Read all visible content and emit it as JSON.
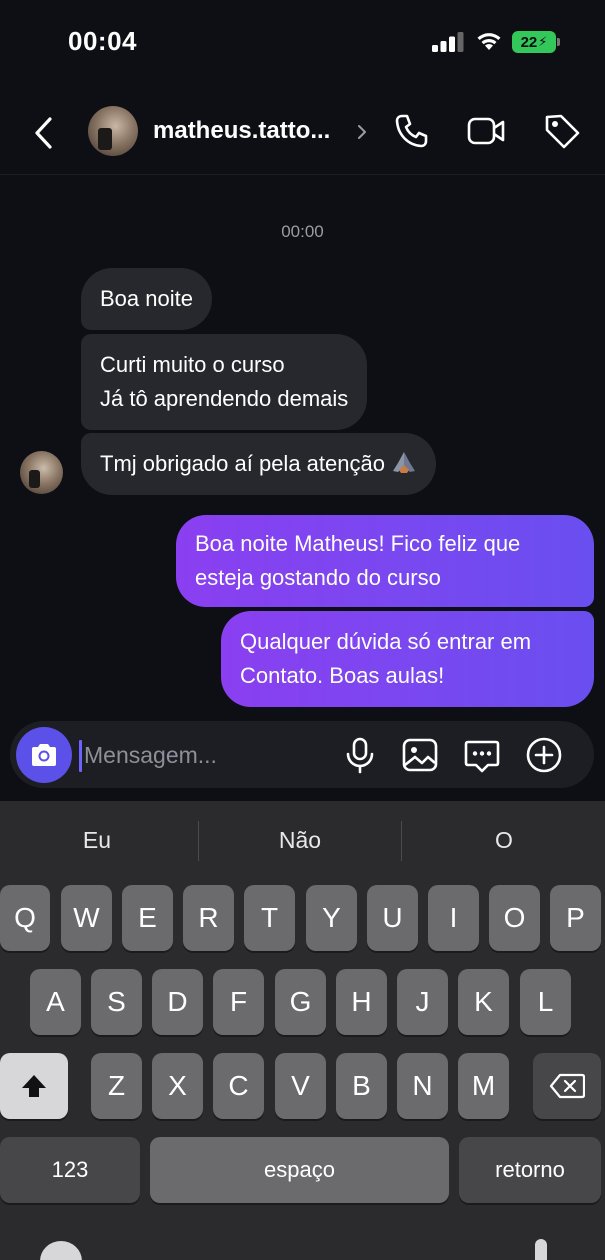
{
  "status": {
    "time": "00:04",
    "battery": "22"
  },
  "header": {
    "username": "matheus.tatto..."
  },
  "conversation": {
    "timestamp": "00:00",
    "incoming": [
      {
        "lines": [
          "Boa noite"
        ]
      },
      {
        "lines": [
          "Curti muito o curso",
          "Já tô aprendendo demais"
        ]
      },
      {
        "lines": [
          "Tmj obrigado aí pela atenção"
        ]
      }
    ],
    "outgoing": [
      {
        "lines": [
          "Boa noite Matheus! Fico feliz que",
          "esteja gostando do curso"
        ]
      },
      {
        "lines": [
          "Qualquer dúvida só entrar em",
          "Contato. Boas aulas!"
        ]
      }
    ]
  },
  "composer": {
    "placeholder": "Mensagem..."
  },
  "keyboard": {
    "suggestions": [
      "Eu",
      "Não",
      "O"
    ],
    "row1": [
      "Q",
      "W",
      "E",
      "R",
      "T",
      "Y",
      "U",
      "I",
      "O",
      "P"
    ],
    "row2": [
      "A",
      "S",
      "D",
      "F",
      "G",
      "H",
      "J",
      "K",
      "L"
    ],
    "row3": [
      "Z",
      "X",
      "C",
      "V",
      "B",
      "N",
      "M"
    ],
    "numbers_label": "123",
    "space_label": "espaço",
    "return_label": "retorno"
  },
  "icons": {
    "back": "chevron-left-icon",
    "call": "phone-icon",
    "video": "video-camera-icon",
    "tag": "tag-icon",
    "camera": "camera-icon",
    "mic": "microphone-icon",
    "gallery": "image-icon",
    "sticker": "message-dots-icon",
    "add": "plus-circle-icon",
    "shift": "shift-icon",
    "backspace": "backspace-icon",
    "emoji": "folded-hands-emoji"
  },
  "colors": {
    "accent": "#5b51e8",
    "outgoing_start": "#8a3ff0",
    "outgoing_end": "#6a4ff0",
    "incoming": "#26282e"
  }
}
